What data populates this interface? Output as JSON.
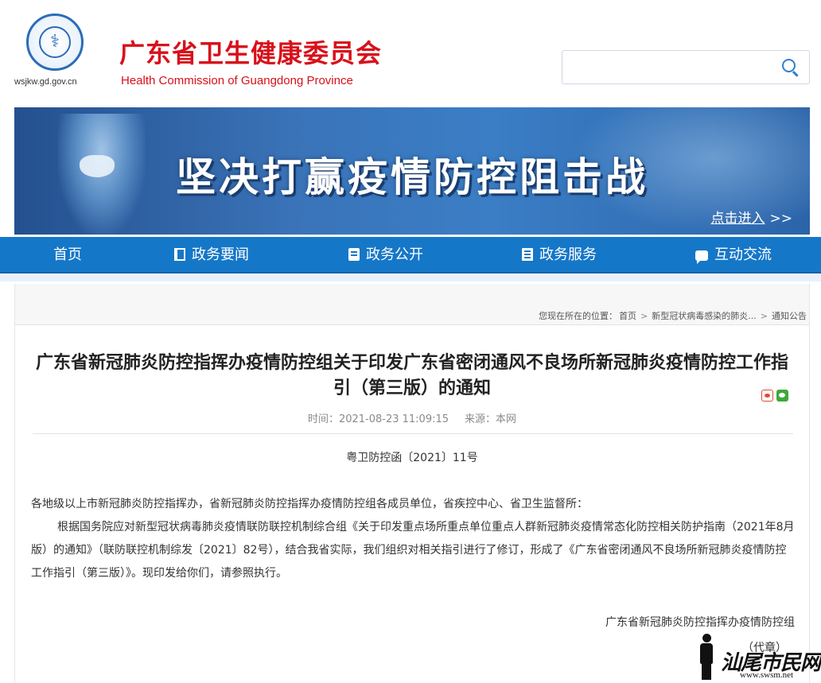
{
  "header": {
    "site_url": "wsjkw.gd.gov.cn",
    "name_cn": "广东省卫生健康委员会",
    "name_en": "Health Commission of Guangdong Province",
    "search_placeholder": "",
    "brand_color": "#d8101a"
  },
  "banner": {
    "title": "坚决打赢疫情防控阻击战",
    "enter_label": "点击进入",
    "enter_chevron": ">>"
  },
  "nav": {
    "items": [
      {
        "label": "首页",
        "icon": ""
      },
      {
        "label": "政务要闻",
        "icon": "news-icon"
      },
      {
        "label": "政务公开",
        "icon": "document-icon"
      },
      {
        "label": "政务服务",
        "icon": "list-icon"
      },
      {
        "label": "互动交流",
        "icon": "chat-icon"
      }
    ],
    "color": "#1577c8"
  },
  "breadcrumb": {
    "prefix": "您现在所在的位置：",
    "items": [
      "首页",
      "新型冠状病毒感染的肺炎...",
      "通知公告"
    ],
    "separator": ">"
  },
  "article": {
    "title": "广东省新冠肺炎防控指挥办疫情防控组关于印发广东省密闭通风不良场所新冠肺炎疫情防控工作指引（第三版）的通知",
    "time": "时间：2021-08-23 11:09:15",
    "source": "来源：本网",
    "doc_number": "粤卫防控函〔2021〕11号",
    "para1": "各地级以上市新冠肺炎防控指挥办，省新冠肺炎防控指挥办疫情防控组各成员单位，省疾控中心、省卫生监督所：",
    "para2": "根据国务院应对新型冠状病毒肺炎疫情联防联控机制综合组《关于印发重点场所重点单位重点人群新冠肺炎疫情常态化防控相关防护指南（2021年8月版）的通知》（联防联控机制综发〔2021〕82号），结合我省实际，我们组织对相关指引进行了修订，形成了《广东省密闭通风不良场所新冠肺炎疫情防控工作指引（第三版）》。现印发给你们，请参照执行。",
    "signer": "广东省新冠肺炎防控指挥办疫情防控组",
    "seal_note": "（代章）"
  },
  "watermark": {
    "brand": "汕尾市民网",
    "url": "www.swsm.net"
  }
}
